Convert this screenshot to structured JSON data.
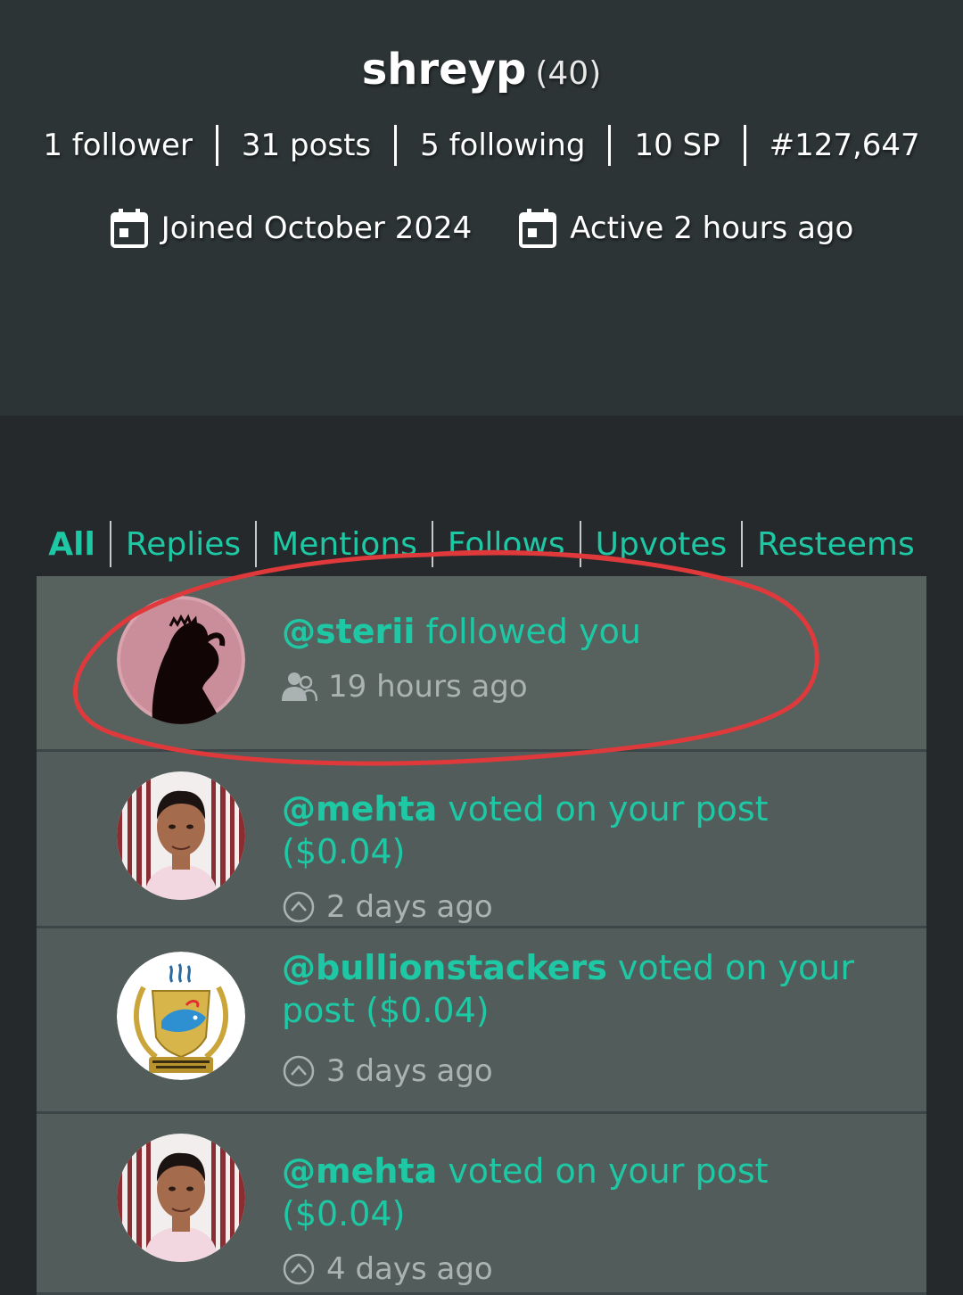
{
  "profile": {
    "username": "shreyp",
    "reputation": "(40)",
    "stats": [
      "1 follower",
      "31 posts",
      "5 following",
      "10 SP",
      "#127,647"
    ],
    "joined": "Joined October 2024",
    "active": "Active 2 hours ago"
  },
  "tabs": [
    {
      "label": "All",
      "active": true
    },
    {
      "label": "Replies"
    },
    {
      "label": "Mentions"
    },
    {
      "label": "Follows"
    },
    {
      "label": "Upvotes"
    },
    {
      "label": "Resteems"
    }
  ],
  "notifications": [
    {
      "handle": "@sterii",
      "text": " followed you",
      "time": "19 hours ago",
      "icon": "users-icon"
    },
    {
      "handle": "@mehta",
      "text": " voted on your post ($0.04)",
      "time": "2 days ago",
      "icon": "upvote-icon"
    },
    {
      "handle": "@bullionstackers",
      "text": " voted on your post ($0.04)",
      "time": "3 days ago",
      "icon": "upvote-icon"
    },
    {
      "handle": "@mehta",
      "text": " voted on your post ($0.04)",
      "time": "4 days ago",
      "icon": "upvote-icon"
    }
  ],
  "colors": {
    "accent": "#1ec8a4",
    "annotation": "#e0393b"
  }
}
